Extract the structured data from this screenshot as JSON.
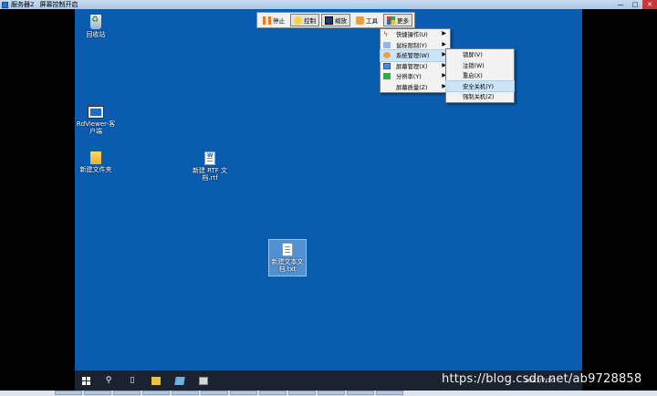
{
  "window": {
    "title": "服务器2",
    "status": "屏幕控制开启",
    "controls": [
      "—",
      "□",
      "✕"
    ]
  },
  "toolbar": {
    "buttons": [
      {
        "label": "停止",
        "icon": "pause-icon"
      },
      {
        "label": "控制",
        "icon": "control-icon",
        "pressed": true
      },
      {
        "label": "缩放",
        "icon": "zoom-icon",
        "pressed": true
      },
      {
        "label": "工具",
        "icon": "tools-icon"
      },
      {
        "label": "更多",
        "icon": "more-icon",
        "pressed": true
      }
    ]
  },
  "menu": {
    "items": [
      {
        "label": "快捷操作(U)",
        "icon": "lightning-icon",
        "submenu": true
      },
      {
        "label": "鼠标限制(Y)",
        "icon": "mouse-icon",
        "submenu": true
      },
      {
        "label": "系统管理(W)",
        "icon": "system-icon",
        "submenu": true,
        "highlighted": true
      },
      {
        "label": "屏幕管理(X)",
        "icon": "screen-icon",
        "submenu": true
      },
      {
        "label": "分辨率(Y)",
        "icon": "resolution-icon",
        "submenu": true
      },
      {
        "label": "屏幕质量(Z)",
        "icon": "",
        "submenu": true
      }
    ]
  },
  "submenu": {
    "items": [
      {
        "label": "锁屏(V)"
      },
      {
        "label": "注销(W)"
      },
      {
        "label": "重启(X)"
      },
      {
        "label": "安全关机(Y)",
        "highlighted": true
      },
      {
        "label": "强制关机(Z)"
      }
    ]
  },
  "desktop": {
    "background": "#0a5cb0",
    "icons": [
      {
        "label": "回收站",
        "type": "recycle-bin-icon"
      },
      {
        "label": "RdViewer-客户端",
        "type": "rdviewer-icon"
      },
      {
        "label": "新建文件夹",
        "type": "folder-icon"
      },
      {
        "label": "新建 RTF 文档.rtf",
        "type": "rtf-document-icon"
      },
      {
        "label": "新建文本文档.txt",
        "type": "text-document-icon",
        "selected": true
      }
    ]
  },
  "taskbar": {
    "clock_time": "",
    "clock_date": "2021/7/10"
  },
  "watermark": "https://blog.csdn.net/ab9728858"
}
